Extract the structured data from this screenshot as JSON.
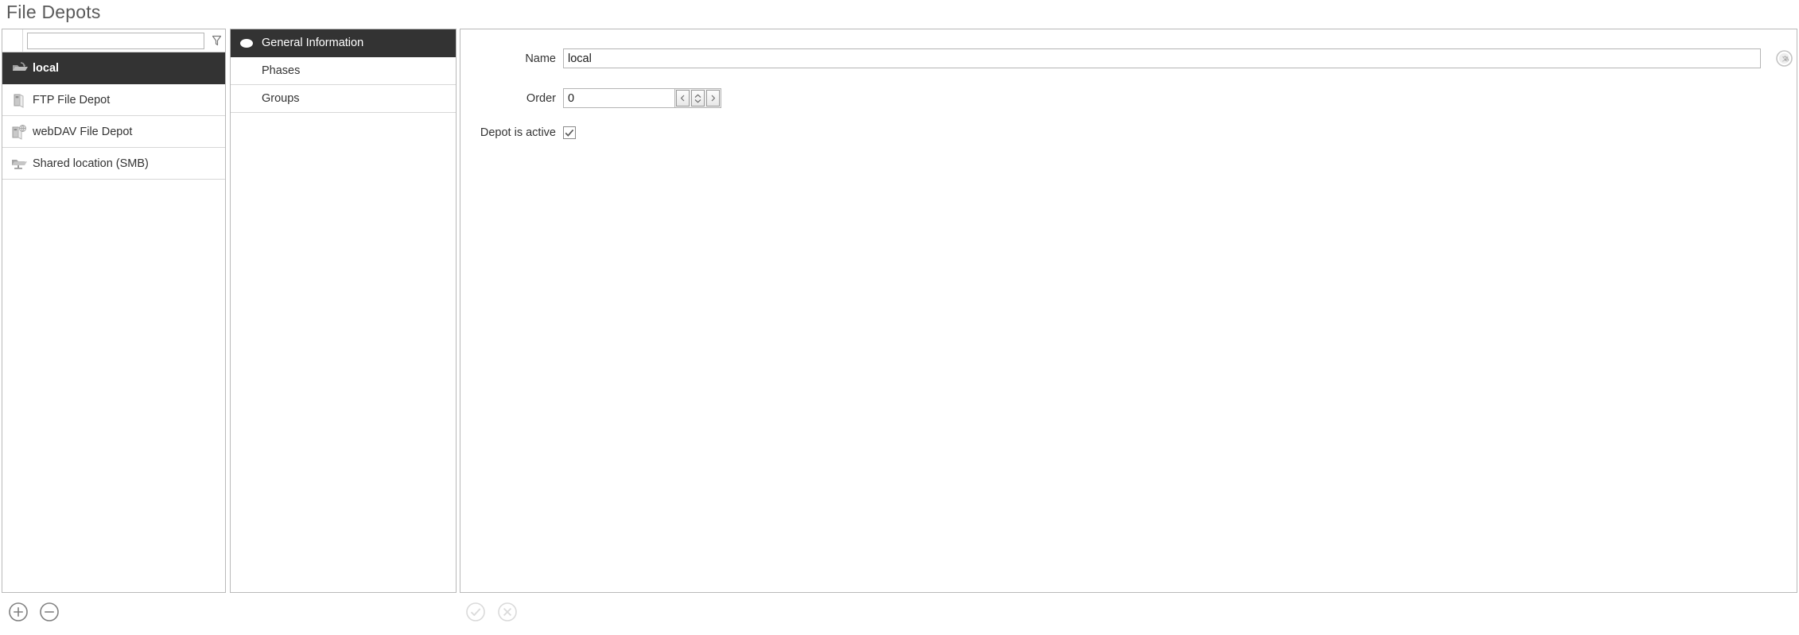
{
  "page": {
    "title": "File Depots"
  },
  "sidebar": {
    "filter": {
      "value": "",
      "placeholder": "",
      "icon": "filter-funnel-icon"
    },
    "items": [
      {
        "label": "local",
        "icon": "depot-local-icon",
        "selected": true
      },
      {
        "label": "FTP File Depot",
        "icon": "depot-ftp-icon",
        "selected": false
      },
      {
        "label": "webDAV File Depot",
        "icon": "depot-webdav-icon",
        "selected": false
      },
      {
        "label": "Shared location (SMB)",
        "icon": "depot-smb-icon",
        "selected": false
      }
    ],
    "actions": [
      {
        "label": "Add",
        "icon": "plus-circle-icon"
      },
      {
        "label": "Remove",
        "icon": "minus-circle-icon"
      }
    ]
  },
  "nav": {
    "items": [
      {
        "label": "General Information",
        "active": true
      },
      {
        "label": "Phases",
        "active": false
      },
      {
        "label": "Groups",
        "active": false
      }
    ]
  },
  "form": {
    "name": {
      "label": "Name",
      "value": "local",
      "placeholder": ""
    },
    "order": {
      "label": "Order",
      "value": "0",
      "placeholder": "",
      "spinner": {
        "prev_icon": "chevron-left-icon",
        "up_icon": "chevron-up-icon",
        "down_icon": "chevron-down-icon",
        "next_icon": "chevron-right-icon"
      }
    },
    "active": {
      "label": "Depot is active",
      "checked": true
    },
    "translate_button": {
      "icon": "translate-icon",
      "label": "Translate"
    },
    "actions": [
      {
        "label": "Confirm",
        "icon": "check-circle-icon",
        "enabled": false
      },
      {
        "label": "Cancel",
        "icon": "cancel-circle-icon",
        "enabled": false
      }
    ]
  },
  "colors": {
    "selection_bg": "#333333",
    "panel_border": "#b9b9b9",
    "row_border": "#d7d7d7",
    "text": "#333333",
    "title": "#5a5a5a",
    "disabled_icon": "#d9d9d9",
    "enabled_icon": "#808080"
  }
}
